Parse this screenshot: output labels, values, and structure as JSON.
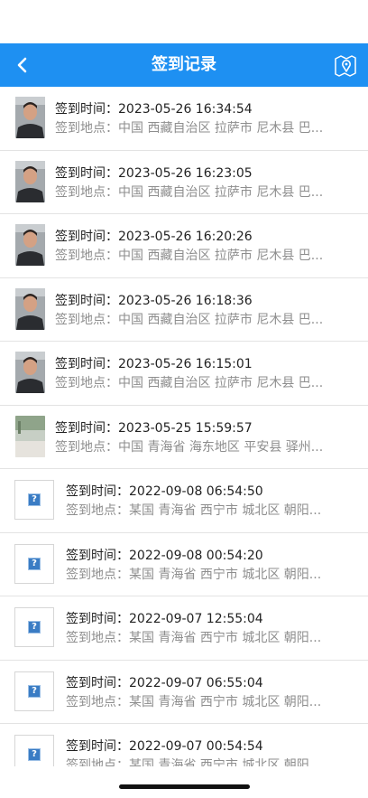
{
  "header": {
    "title": "签到记录",
    "back_icon": "chevron-left-icon",
    "map_icon": "map-pin-icon"
  },
  "colors": {
    "nav_bg": "#1e90f2",
    "label": "#222222",
    "address": "#8e8e8e"
  },
  "labels": {
    "time": "签到时间：",
    "place": "签到地点："
  },
  "records": [
    {
      "thumb": "photo",
      "time": "2023-05-26 16:34:54",
      "place": "中国 西藏自治区 拉萨市 尼木县 巴..."
    },
    {
      "thumb": "photo",
      "time": "2023-05-26 16:23:05",
      "place": "中国 西藏自治区 拉萨市 尼木县 巴..."
    },
    {
      "thumb": "photo",
      "time": "2023-05-26 16:20:26",
      "place": "中国 西藏自治区 拉萨市 尼木县 巴..."
    },
    {
      "thumb": "photo",
      "time": "2023-05-26 16:18:36",
      "place": "中国 西藏自治区 拉萨市 尼木县 巴..."
    },
    {
      "thumb": "photo",
      "time": "2023-05-26 16:15:01",
      "place": "中国 西藏自治区 拉萨市 尼木县 巴..."
    },
    {
      "thumb": "photo-alt",
      "time": "2023-05-25 15:59:57",
      "place": "中国 青海省 海东地区 平安县 驿州..."
    },
    {
      "thumb": "placeholder",
      "time": "2022-09-08 06:54:50",
      "place": "某国 青海省 西宁市 城北区 朝阳..."
    },
    {
      "thumb": "placeholder",
      "time": "2022-09-08 00:54:20",
      "place": "某国 青海省 西宁市 城北区 朝阳..."
    },
    {
      "thumb": "placeholder",
      "time": "2022-09-07 12:55:04",
      "place": "某国 青海省 西宁市 城北区 朝阳..."
    },
    {
      "thumb": "placeholder",
      "time": "2022-09-07 06:55:04",
      "place": "某国 青海省 西宁市 城北区 朝阳..."
    },
    {
      "thumb": "placeholder",
      "time": "2022-09-07 00:54:54",
      "place": "某国 青海省 西宁市 城北区 朝阳..."
    }
  ]
}
